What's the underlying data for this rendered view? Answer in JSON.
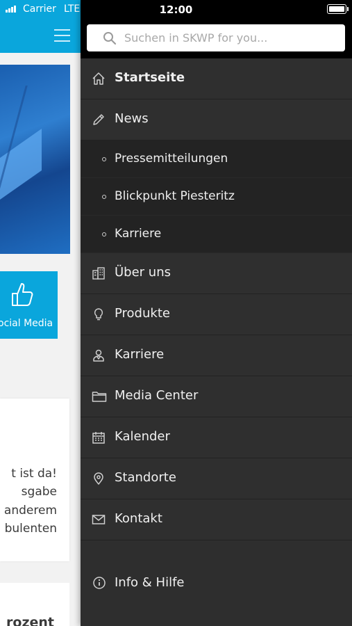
{
  "status_bar": {
    "carrier": "Carrier",
    "network": "LTE",
    "time": "12:00"
  },
  "background": {
    "social_label": "ocial Media",
    "card_lines": [
      "t ist da!",
      "sgabe",
      "anderem",
      "bulenten"
    ],
    "card2_line": "rozent"
  },
  "search": {
    "placeholder": "Suchen in SKWP for you..."
  },
  "menu": {
    "items": [
      {
        "label": "Startseite",
        "icon": "home-icon"
      },
      {
        "label": "News",
        "icon": "pencil-icon"
      },
      {
        "label": "Über uns",
        "icon": "building-icon"
      },
      {
        "label": "Produkte",
        "icon": "lightbulb-icon"
      },
      {
        "label": "Karriere",
        "icon": "person-icon"
      },
      {
        "label": "Media Center",
        "icon": "folder-icon"
      },
      {
        "label": "Kalender",
        "icon": "calendar-icon"
      },
      {
        "label": "Standorte",
        "icon": "location-pin-icon"
      },
      {
        "label": "Kontakt",
        "icon": "mail-icon"
      }
    ],
    "news_sub": [
      {
        "label": "Pressemitteilungen"
      },
      {
        "label": "Blickpunkt Piesteritz"
      },
      {
        "label": "Karriere"
      }
    ],
    "footer_item": {
      "label": "Info & Hilfe",
      "icon": "info-icon"
    }
  },
  "colors": {
    "brand_blue": "#0aa6dc",
    "drawer_bg": "#2e2e2e",
    "submenu_bg": "#232323"
  }
}
